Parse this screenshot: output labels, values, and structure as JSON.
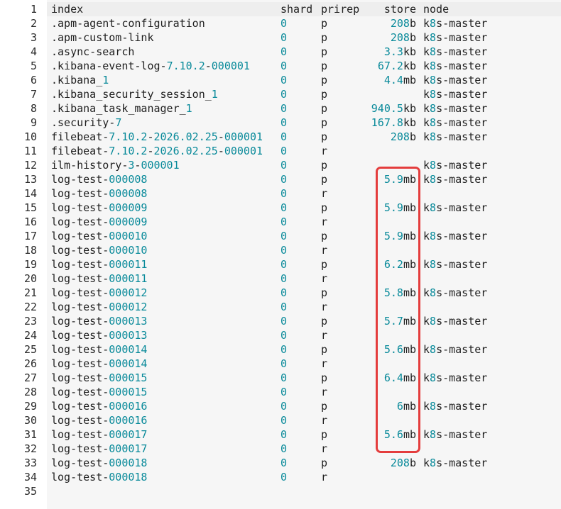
{
  "header": {
    "index": "index",
    "shard": "shard",
    "prirep": "prirep",
    "store": "store",
    "node": "node"
  },
  "rows": [
    {
      "index": ".apm-agent-configuration",
      "shard": "0",
      "prirep": "p",
      "store": "208b",
      "node": "k8s-master"
    },
    {
      "index": ".apm-custom-link",
      "shard": "0",
      "prirep": "p",
      "store": "208b",
      "node": "k8s-master"
    },
    {
      "index": ".async-search",
      "shard": "0",
      "prirep": "p",
      "store": "3.3kb",
      "node": "k8s-master"
    },
    {
      "index": ".kibana-event-log-7.10.2-000001",
      "shard": "0",
      "prirep": "p",
      "store": "67.2kb",
      "node": "k8s-master"
    },
    {
      "index": ".kibana_1",
      "shard": "0",
      "prirep": "p",
      "store": "4.4mb",
      "node": "k8s-master"
    },
    {
      "index": ".kibana_security_session_1",
      "shard": "0",
      "prirep": "p",
      "store": "",
      "node": "k8s-master"
    },
    {
      "index": ".kibana_task_manager_1",
      "shard": "0",
      "prirep": "p",
      "store": "940.5kb",
      "node": "k8s-master"
    },
    {
      "index": ".security-7",
      "shard": "0",
      "prirep": "p",
      "store": "167.8kb",
      "node": "k8s-master"
    },
    {
      "index": "filebeat-7.10.2-2026.02.25-000001",
      "shard": "0",
      "prirep": "p",
      "store": "208b",
      "node": "k8s-master"
    },
    {
      "index": "filebeat-7.10.2-2026.02.25-000001",
      "shard": "0",
      "prirep": "r",
      "store": "",
      "node": ""
    },
    {
      "index": "ilm-history-3-000001",
      "shard": "0",
      "prirep": "p",
      "store": "",
      "node": "k8s-master"
    },
    {
      "index": "log-test-000008",
      "shard": "0",
      "prirep": "p",
      "store": "5.9mb",
      "node": "k8s-master"
    },
    {
      "index": "log-test-000008",
      "shard": "0",
      "prirep": "r",
      "store": "",
      "node": ""
    },
    {
      "index": "log-test-000009",
      "shard": "0",
      "prirep": "p",
      "store": "5.9mb",
      "node": "k8s-master"
    },
    {
      "index": "log-test-000009",
      "shard": "0",
      "prirep": "r",
      "store": "",
      "node": ""
    },
    {
      "index": "log-test-000010",
      "shard": "0",
      "prirep": "p",
      "store": "5.9mb",
      "node": "k8s-master"
    },
    {
      "index": "log-test-000010",
      "shard": "0",
      "prirep": "r",
      "store": "",
      "node": ""
    },
    {
      "index": "log-test-000011",
      "shard": "0",
      "prirep": "p",
      "store": "6.2mb",
      "node": "k8s-master"
    },
    {
      "index": "log-test-000011",
      "shard": "0",
      "prirep": "r",
      "store": "",
      "node": ""
    },
    {
      "index": "log-test-000012",
      "shard": "0",
      "prirep": "p",
      "store": "5.8mb",
      "node": "k8s-master"
    },
    {
      "index": "log-test-000012",
      "shard": "0",
      "prirep": "r",
      "store": "",
      "node": ""
    },
    {
      "index": "log-test-000013",
      "shard": "0",
      "prirep": "p",
      "store": "5.7mb",
      "node": "k8s-master"
    },
    {
      "index": "log-test-000013",
      "shard": "0",
      "prirep": "r",
      "store": "",
      "node": ""
    },
    {
      "index": "log-test-000014",
      "shard": "0",
      "prirep": "p",
      "store": "5.6mb",
      "node": "k8s-master"
    },
    {
      "index": "log-test-000014",
      "shard": "0",
      "prirep": "r",
      "store": "",
      "node": ""
    },
    {
      "index": "log-test-000015",
      "shard": "0",
      "prirep": "p",
      "store": "6.4mb",
      "node": "k8s-master"
    },
    {
      "index": "log-test-000015",
      "shard": "0",
      "prirep": "r",
      "store": "",
      "node": ""
    },
    {
      "index": "log-test-000016",
      "shard": "0",
      "prirep": "p",
      "store": "6mb",
      "node": "k8s-master"
    },
    {
      "index": "log-test-000016",
      "shard": "0",
      "prirep": "r",
      "store": "",
      "node": ""
    },
    {
      "index": "log-test-000017",
      "shard": "0",
      "prirep": "p",
      "store": "5.6mb",
      "node": "k8s-master"
    },
    {
      "index": "log-test-000017",
      "shard": "0",
      "prirep": "r",
      "store": "",
      "node": ""
    },
    {
      "index": "log-test-000018",
      "shard": "0",
      "prirep": "p",
      "store": "208b",
      "node": "k8s-master"
    },
    {
      "index": "log-test-000018",
      "shard": "0",
      "prirep": "r",
      "store": "",
      "node": ""
    }
  ],
  "line_numbers": [
    "1",
    "2",
    "3",
    "4",
    "5",
    "6",
    "7",
    "8",
    "9",
    "10",
    "11",
    "12",
    "13",
    "14",
    "15",
    "16",
    "17",
    "18",
    "19",
    "20",
    "21",
    "22",
    "23",
    "24",
    "25",
    "26",
    "27",
    "28",
    "29",
    "30",
    "31",
    "32",
    "33",
    "34",
    "35"
  ],
  "colors": {
    "number": "#098a9a",
    "text": "#1f1f1f",
    "highlight": "#e43d3d",
    "editor_bg": "#f6f6f6"
  }
}
